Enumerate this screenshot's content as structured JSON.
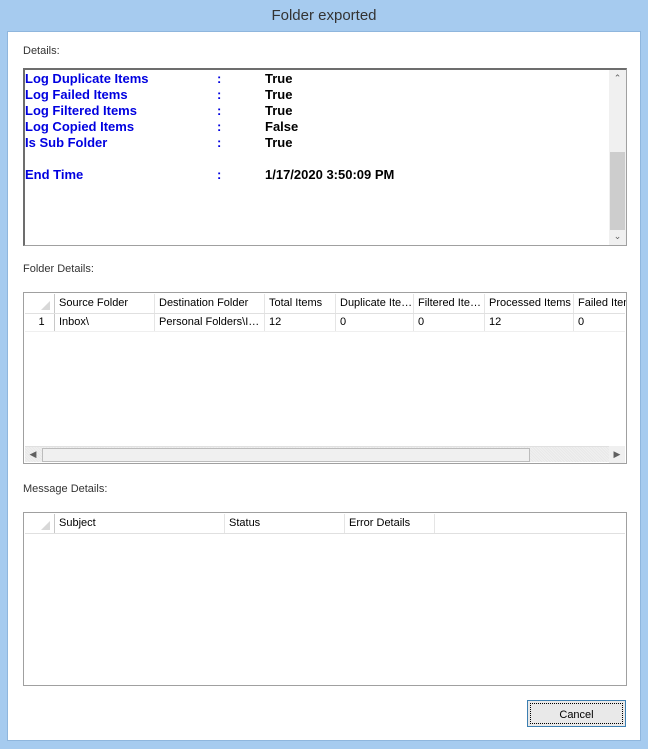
{
  "window": {
    "title": "Folder exported"
  },
  "details": {
    "label": "Details:",
    "rows": [
      {
        "key": "Log Duplicate Items",
        "sep": ":",
        "value": "True"
      },
      {
        "key": "Log Failed Items",
        "sep": ":",
        "value": "True"
      },
      {
        "key": "Log Filtered Items",
        "sep": ":",
        "value": "True"
      },
      {
        "key": "Log Copied Items",
        "sep": ":",
        "value": "False"
      },
      {
        "key": "Is Sub Folder",
        "sep": ":",
        "value": "True"
      },
      {
        "key": "",
        "sep": "",
        "value": ""
      },
      {
        "key": "End Time",
        "sep": ":",
        "value": "1/17/2020 3:50:09 PM"
      }
    ]
  },
  "folder_details": {
    "label": "Folder Details:",
    "columns": [
      "Source Folder",
      "Destination Folder",
      "Total Items",
      "Duplicate Items",
      "Filtered Items",
      "Processed Items",
      "Failed Items"
    ],
    "rows": [
      {
        "index": "1",
        "cells": [
          "Inbox\\",
          "Personal Folders\\Inbox",
          "12",
          "0",
          "0",
          "12",
          "0"
        ]
      }
    ]
  },
  "message_details": {
    "label": "Message Details:",
    "columns": [
      "Subject",
      "Status",
      "Error Details"
    ],
    "rows": []
  },
  "buttons": {
    "cancel": "Cancel"
  }
}
